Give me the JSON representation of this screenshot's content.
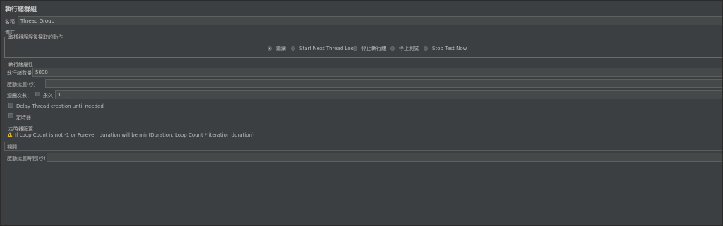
{
  "panel": {
    "title": "執行緒群組"
  },
  "name_row": {
    "label": "名稱",
    "value": "Thread Group"
  },
  "comment_row": {
    "label": "備註"
  },
  "error_action": {
    "legend": "取樣器誤誤後採取的動作",
    "options": [
      {
        "label": "繼續",
        "checked": true
      },
      {
        "label": "Start Next Thread Loop",
        "checked": false
      },
      {
        "label": "停止執行緒",
        "checked": false
      },
      {
        "label": "停止測試",
        "checked": false
      },
      {
        "label": "Stop Test Now",
        "checked": false
      }
    ]
  },
  "thread_props": {
    "heading": "執行緒屬性",
    "num_threads_label": "執行緒數量",
    "num_threads_value": "5000",
    "ramp_up_label": "啟動延遲(秒)",
    "ramp_up_value": "",
    "loop_label": "迴圈次數：",
    "forever_label": "永久",
    "loop_value": "1",
    "delay_creation_label": "Delay Thread creation until needed",
    "scheduler_label": "定時器"
  },
  "scheduler_config": {
    "heading": "定時器配置",
    "warning": "If Loop Count is not -1 or Forever, duration will be min(Duration, Loop Count * iteration duration)",
    "duration_label": "期間",
    "duration_value": "",
    "startup_delay_label": "啟動延遲時間(秒)",
    "startup_delay_value": ""
  },
  "icons": {
    "warning": "warning-icon"
  },
  "colors": {
    "background": "#3c3f41",
    "field": "#45494a",
    "text": "#bbbbbb",
    "warning": "#e6b422"
  }
}
